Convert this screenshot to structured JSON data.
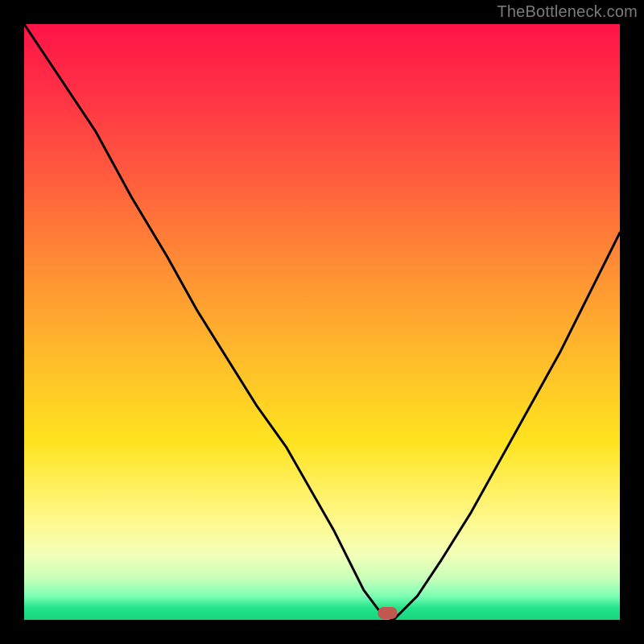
{
  "watermark": "TheBottleneck.com",
  "chart_data": {
    "type": "line",
    "title": "",
    "xlabel": "",
    "ylabel": "",
    "xlim": [
      0,
      100
    ],
    "ylim": [
      0,
      100
    ],
    "background_gradient": {
      "direction": "vertical",
      "stops": [
        {
          "pos": 0,
          "color": "#ff1447"
        },
        {
          "pos": 10,
          "color": "#ff2d46"
        },
        {
          "pos": 25,
          "color": "#ff5a3e"
        },
        {
          "pos": 40,
          "color": "#ff8b35"
        },
        {
          "pos": 55,
          "color": "#ffb92b"
        },
        {
          "pos": 70,
          "color": "#ffe31f"
        },
        {
          "pos": 83,
          "color": "#fff88a"
        },
        {
          "pos": 89,
          "color": "#f3ffb8"
        },
        {
          "pos": 93,
          "color": "#c9ffba"
        },
        {
          "pos": 96,
          "color": "#7dffb4"
        },
        {
          "pos": 98,
          "color": "#23e48a"
        },
        {
          "pos": 100,
          "color": "#17d67f"
        }
      ]
    },
    "series": [
      {
        "name": "bottleneck-curve",
        "color": "#000000",
        "x": [
          0,
          6,
          12,
          18,
          24,
          29,
          34,
          39,
          44,
          48,
          52,
          55,
          57,
          60,
          62,
          66,
          70,
          75,
          80,
          85,
          90,
          95,
          100
        ],
        "y": [
          100,
          91,
          82,
          71,
          61,
          52,
          44,
          36,
          29,
          22,
          15,
          9,
          5,
          1,
          0,
          4,
          10,
          18,
          27,
          36,
          45,
          55,
          65
        ]
      }
    ],
    "marker": {
      "name": "optimal-point",
      "shape": "rounded-rect",
      "x": 61,
      "y": 0,
      "color": "#c1584f"
    }
  }
}
